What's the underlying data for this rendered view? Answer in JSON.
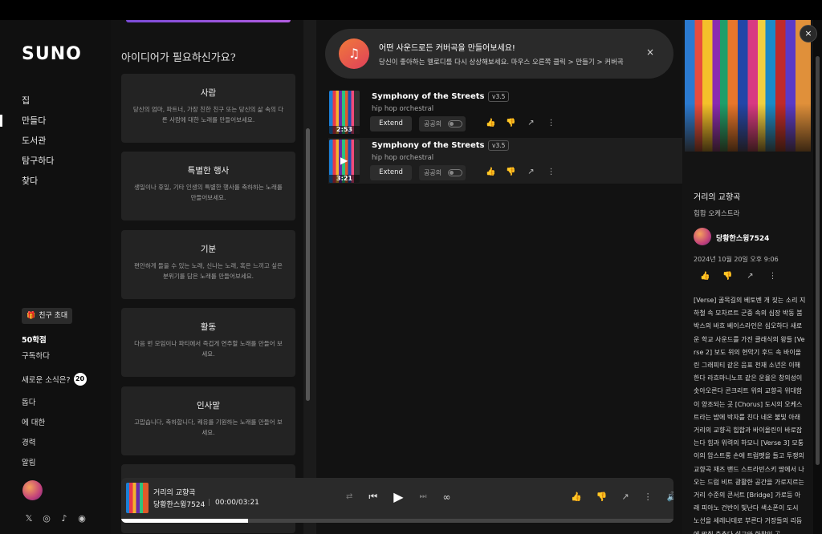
{
  "sidebar": {
    "logo": "SUNO",
    "nav": [
      {
        "label": "집",
        "active": false
      },
      {
        "label": "만들다",
        "active": true
      },
      {
        "label": "도서관",
        "active": false
      },
      {
        "label": "탐구하다",
        "active": false
      },
      {
        "label": "찾다",
        "active": false
      }
    ],
    "invite_label": "친구 초대",
    "credits": "50학점",
    "subscribe": "구독하다",
    "news_label": "새로운 소식은?",
    "news_count": "20",
    "links": [
      "돕다",
      "에 대한",
      "경력",
      "알림"
    ],
    "socials": [
      "x-icon",
      "instagram-icon",
      "tiktok-icon",
      "discord-icon"
    ]
  },
  "ideas": {
    "title": "아이디어가 필요하신가요?",
    "cards": [
      {
        "title": "사람",
        "desc": "당신의 엄마, 파트너, 가장 친한 친구 또는 당신의 삶 속의 다른 사람에 대한 노래를 만들어보세요."
      },
      {
        "title": "특별한 행사",
        "desc": "생일이나 휴일, 기타 인생의 특별한 행사를 축하하는 노래를 만들어보세요."
      },
      {
        "title": "기분",
        "desc": "편안하게 들을 수 있는 노래, 신나는 노래, 혹은 느끼고 싶은 분위기를 담은 노래를 만들어보세요."
      },
      {
        "title": "활동",
        "desc": "다음 번 모임이나 파티에서 즉겁게 연주할 노래를 만들어 보세요."
      },
      {
        "title": "인사말",
        "desc": "고맙습니다, 축하합니다, 쾌유를 기원하는 노래를 만들어 보세요."
      }
    ]
  },
  "toast": {
    "title": "어떤 사운드로든 커버곡을 만들어보세요!",
    "subtitle": "당신이 좋아하는 멜로디를 다시 상상해보세요. 마우스 오른쪽 클릭 > 만들기 > 커버곡",
    "close": "×"
  },
  "songs": [
    {
      "title": "Symphony of the Streets",
      "version": "v3.5",
      "genre": "hip hop orchestral",
      "duration": "2:53",
      "extend": "Extend",
      "public": "공공의",
      "selected": false
    },
    {
      "title": "Symphony of the Streets",
      "version": "v3.5",
      "genre": "hip hop orchestral",
      "duration": "3:21",
      "extend": "Extend",
      "public": "공공의",
      "selected": true
    }
  ],
  "detail": {
    "title": "거리의 교향곡",
    "genre": "힙합 오케스트라",
    "user": "당황한스윙7524",
    "date": "2024년 10월 20일 오후 9:06",
    "lyrics": "[Verse] 골목길의 베토벤 개 짖는 소리 지하철 속 모차르트 군중 속의 심장 박동 붐박스의 바흐 베이스라인은 심오하다 새로운 학교 사운드를 가진 클래식의 왕들 [Verse 2] 보도 위의 현악기 후드 속 바이올린 그래피티 같은 음표 천재 소년은 이해한다 라흐마니노프 같은 운율은 창의성이 솟아오른다 콘크리트 위의 교향곡 위대함이 양조되는 곳 [Chorus] 도시의 오케스트라는 밤에 박자를 친다 네온 불빛 아래 거리의 교향곡 힙합과 바이올린이 바로잡는다 힘과 위력의 하모니 [Verse 3] 모퉁이의 암스트롱 손에 트럼펫을 들고 투쟁의 교향곡 재즈 밴드 스트라빈스키 땅에서 나오는 드럼 비트 광활한 공간을 가로지르는 거리 수준의 콘서트 [Bridge] 가로등 아래 피아노 건반이 빛난다 색소폰이 도시 노선을 세레나데로 부른다 거장들의 리듬에 맞춰 춤추다 설교와 한창인 곡",
    "close": "×"
  },
  "player": {
    "title": "거리의 교향곡",
    "artist": "당황한스윙7524",
    "separator": "|",
    "time": "00:00/03:21",
    "progress": 0.23
  }
}
